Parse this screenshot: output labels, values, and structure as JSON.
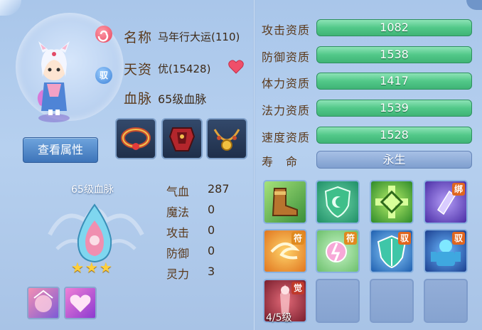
{
  "profile": {
    "name_label": "名称",
    "name_value": "马年行大运(110)",
    "aptitude_label": "天资",
    "aptitude_value": "优(15428)",
    "bloodline_label": "血脉",
    "bloodline_value": "65级血脉",
    "tag_red": "",
    "tag_blue": "驭"
  },
  "view_attributes_button": "查看属性",
  "bloodline_panel": {
    "title": "65级血脉",
    "stars": "★★★",
    "star_count": 3,
    "stats": [
      {
        "label": "气血",
        "value": "287"
      },
      {
        "label": "魔法",
        "value": "0"
      },
      {
        "label": "攻击",
        "value": "0"
      },
      {
        "label": "防御",
        "value": "0"
      },
      {
        "label": "灵力",
        "value": "3"
      }
    ]
  },
  "qualifications": [
    {
      "label": "攻击资质",
      "value": "1082"
    },
    {
      "label": "防御资质",
      "value": "1538"
    },
    {
      "label": "体力资质",
      "value": "1417"
    },
    {
      "label": "法力资质",
      "value": "1539"
    },
    {
      "label": "速度资质",
      "value": "1528"
    }
  ],
  "lifespan": {
    "label": "寿　命",
    "value": "永生"
  },
  "skills": {
    "badges": [
      "绑",
      "符",
      "符",
      "驭",
      "驭",
      "觉"
    ],
    "level_text": "4/5级"
  },
  "colors": {
    "bar_green": "#52c889",
    "panel_bg": "#b6d0ef",
    "label_brown": "#5b3a1c"
  },
  "icons": {
    "heart": "heart-icon",
    "stars": "star-icon"
  }
}
